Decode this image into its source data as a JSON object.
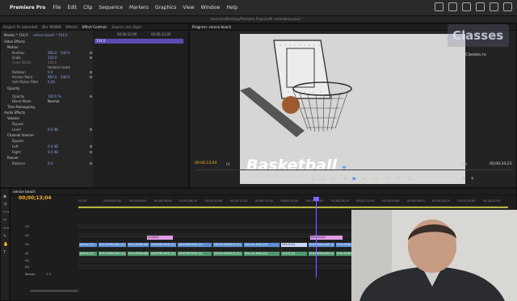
{
  "menubar": {
    "app_name": "Premiere Pro",
    "items": [
      "File",
      "Edit",
      "Clip",
      "Sequence",
      "Markers",
      "Graphics",
      "View",
      "Window",
      "Help"
    ]
  },
  "titlebar": {
    "path": "/Users/oz/Desktop/Premiere Projects/Pr extended.prproj *"
  },
  "effect_controls": {
    "tabs": [
      "Project: Pr extended",
      "Bin: MXBIN",
      "Effects",
      "Effect Controls",
      "Source: (no clips)"
    ],
    "active_tab": "Effect Controls",
    "clip_path": "Master * 154.0",
    "sequence": "venice beach * 154.0",
    "timecode_start": "00;00;12;00",
    "timecode_end": "00;00;13;05",
    "clipbar_label": "154.0",
    "section_video": "Video Effects",
    "motion": "Motion",
    "position_label": "Position",
    "position_x": "960.0",
    "position_y": "540.0",
    "scale_label": "Scale",
    "scale_val": "100.0",
    "scale_width_label": "Scale Width",
    "scale_width_val": "100.0",
    "uniform_scale": "Uniform Scale",
    "rotation_label": "Rotation",
    "rotation_val": "0.0",
    "anchor_label": "Anchor Point",
    "anchor_x": "960.0",
    "anchor_y": "540.0",
    "antiflicker_label": "Anti-flicker Filter",
    "antiflicker_val": "0.00",
    "opacity": "Opacity",
    "opacity_label": "Opacity",
    "opacity_val": "100.0 %",
    "blend_label": "Blend Mode",
    "blend_val": "Normal",
    "time_remap": "Time Remapping",
    "section_audio": "Audio Effects",
    "volume": "Volume",
    "bypass_label": "Bypass",
    "level_label": "Level",
    "level_val": "0.0 dB",
    "channel_volume": "Channel Volume",
    "left_label": "Left",
    "left_val": "0.0 dB",
    "right_label": "Right",
    "right_val": "0.0 dB",
    "panner": "Panner",
    "balance_label": "Balance",
    "balance_val": "0.0"
  },
  "program_monitor": {
    "tab": "Program: venice beach",
    "overlay_title": "Basketball",
    "timecode": "00;00;13;04",
    "fit": "Fit",
    "quality": "Full",
    "duration": "00;00;34;23"
  },
  "watermark": {
    "logo": "Classes",
    "url": "Classes.ru"
  },
  "timeline": {
    "sequence_tab": "venice beach",
    "timecode": "00;00;13;04",
    "ticks": [
      "00;00",
      "00;00;02;00",
      "00;00;04;00",
      "00;00;06;00",
      "00;00;08;00",
      "00;00;10;00",
      "00;00;12;00",
      "00;00;14;00",
      "00;00;16;00",
      "00;00;18;00",
      "00;00;20;00",
      "00;00;22;00",
      "00;00;24;00",
      "00;00;26;00",
      "00;00;28;00",
      "00;00;30;00",
      "00;00;32;00"
    ],
    "tracks": [
      "V3",
      "V2",
      "V1",
      "A1",
      "A2",
      "A3"
    ],
    "master_label": "Master",
    "master_val": "0.0",
    "title_clips": [
      "Subtext",
      "Basketball"
    ],
    "v1_clips": [
      "palms [V]",
      "ROLLERBLADE [V]",
      "ROLLERBLADE [V]",
      "SKATEBOARD [V]",
      "SKATEBOARD [V]",
      "MUSCLEBEACH [V]",
      "Mus on Rolls [V]",
      "154.0 [V]",
      "ROLLERBLADE [V]",
      "ROLLERBLADE [V]"
    ],
    "a1_clips": [
      "palms [A]",
      "ROLLERBLADE [A]",
      "ROLLERBLADE [A]",
      "SKATEBOARD [A]",
      "SKATEBOARD [A]",
      "MUSCLEBEACH [A]",
      "Mus on Rolls [A]",
      "154.0 [A]",
      "ROLLERBLADE [A]",
      "ROLLERBLADE [A]"
    ]
  },
  "colors": {
    "timecode": "#ffb020",
    "playhead": "#7a6cff",
    "video_clip": "#5b8fd6",
    "audio_clip": "#4f9a6d",
    "title_clip": "#e39be6"
  }
}
